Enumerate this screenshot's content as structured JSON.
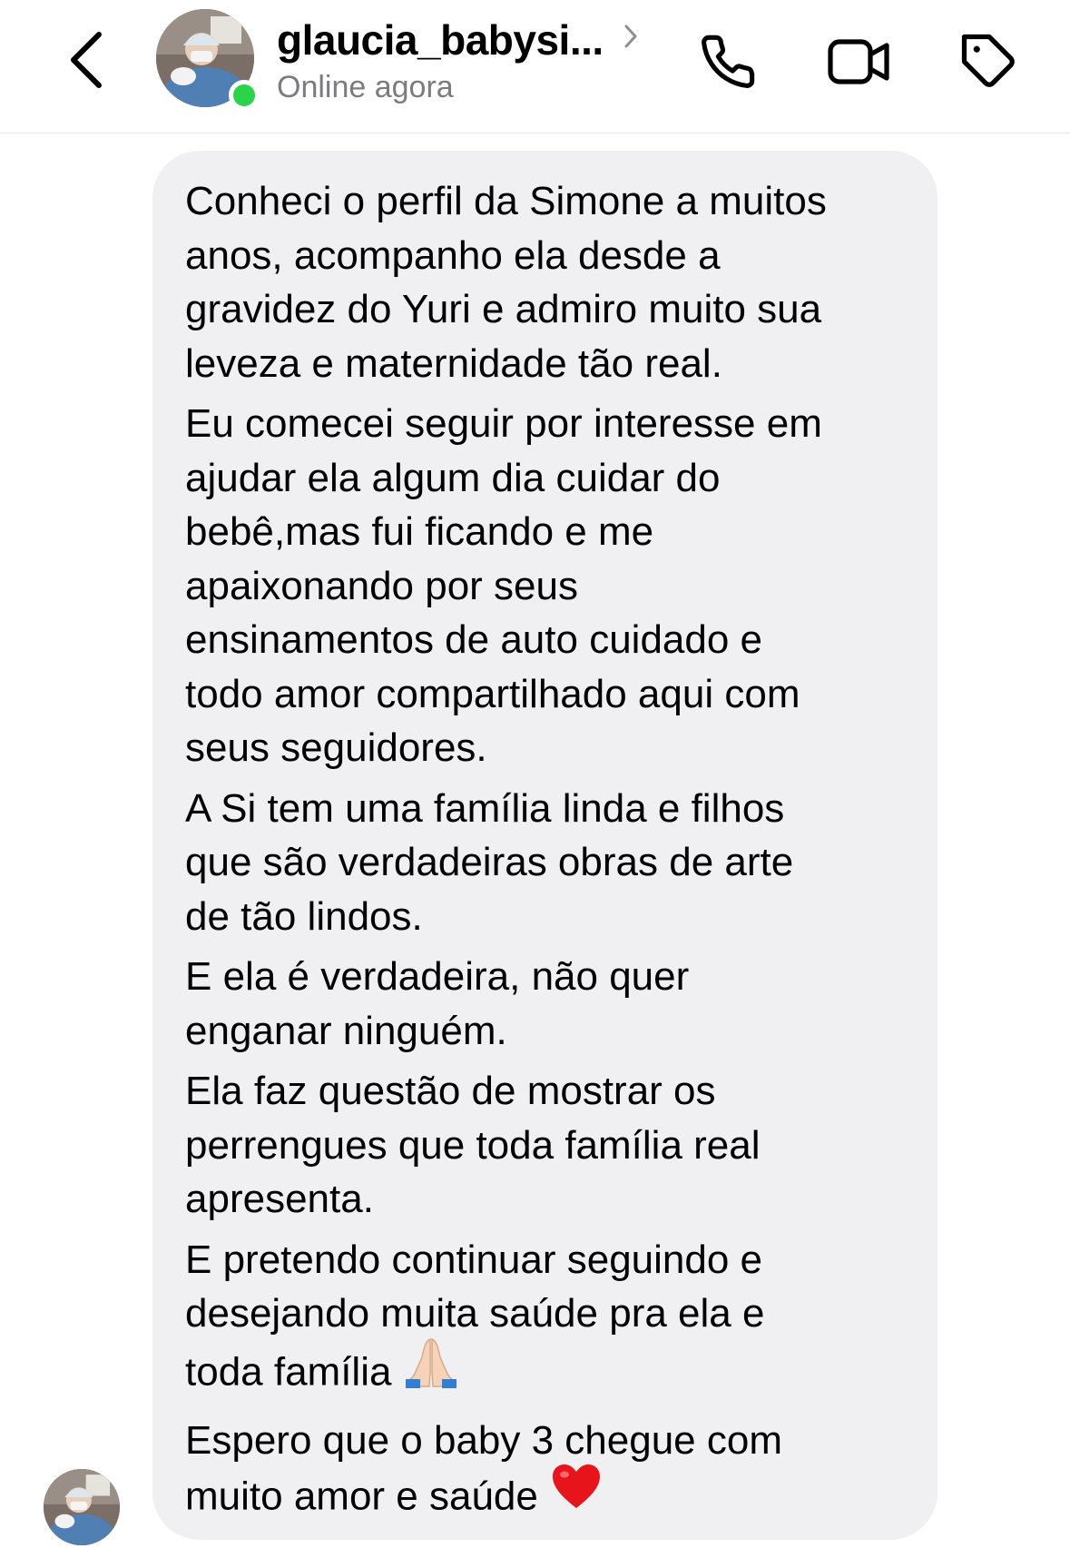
{
  "header": {
    "username": "glaucia_babysi...",
    "status": "Online agora",
    "back_icon": "chevron-left-icon",
    "call_icon": "phone-icon",
    "video_icon": "video-camera-icon",
    "tag_icon": "tag-icon",
    "online_color": "#2ad34a"
  },
  "message": {
    "lines": [
      "Conheci o perfil da Simone a muitos",
      "anos, acompanho ela desde a",
      "gravidez do Yuri e admiro muito sua",
      "leveza e maternidade tão real.",
      "Eu comecei seguir por interesse em",
      "ajudar ela algum dia cuidar do",
      "bebê,mas fui ficando e me",
      "apaixonando por seus",
      "ensinamentos de auto cuidado e",
      "todo amor compartilhado aqui com",
      "seus seguidores.",
      "A Si tem uma família linda e filhos",
      "que são verdadeiras obras de arte",
      "de tão lindos.",
      "E ela é verdadeira, não quer",
      "enganar ninguém.",
      "Ela faz questão de mostrar os",
      "perrengues que toda família real",
      "apresenta.",
      "E pretendo continuar seguindo e",
      "desejando muita saúde pra ela e",
      "toda família",
      "Espero que o baby 3 chegue com",
      "muito amor e saúde"
    ],
    "emojis": {
      "line_21": "praying-hands-emoji",
      "line_23": "red-heart-emoji"
    },
    "bubble_color": "#f0f0f3"
  }
}
